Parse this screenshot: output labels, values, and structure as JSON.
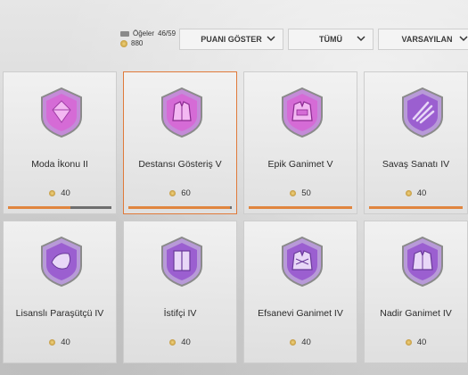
{
  "stats": {
    "items_label": "Öğeler",
    "items_count": "46/59",
    "coins": "880"
  },
  "dropdowns": [
    {
      "label": "PUANI GÖSTER"
    },
    {
      "label": "TÜMÜ"
    },
    {
      "label": "VARSAYILAN"
    }
  ],
  "items": [
    {
      "name": "Moda İkonu II",
      "price": "40",
      "progress": 0.6,
      "selected": false
    },
    {
      "name": "Destansı Gösteriş V",
      "price": "60",
      "progress": 0.98,
      "selected": true
    },
    {
      "name": "Epik Ganimet V",
      "price": "50",
      "progress": 1.0,
      "selected": false
    },
    {
      "name": "Savaş Sanatı IV",
      "price": "40",
      "progress": 1.0,
      "selected": false
    },
    {
      "name": "Lisanslı Paraşütçü IV",
      "price": "40",
      "progress": null,
      "selected": false
    },
    {
      "name": "İstifçi IV",
      "price": "40",
      "progress": null,
      "selected": false
    },
    {
      "name": "Efsanevi Ganimet IV",
      "price": "40",
      "progress": null,
      "selected": false
    },
    {
      "name": "Nadir Ganimet IV",
      "price": "40",
      "progress": null,
      "selected": false
    }
  ],
  "colors": {
    "accent": "#e07a3a",
    "badge_purple": "#9b5fd0",
    "badge_pink": "#d45bd4"
  }
}
